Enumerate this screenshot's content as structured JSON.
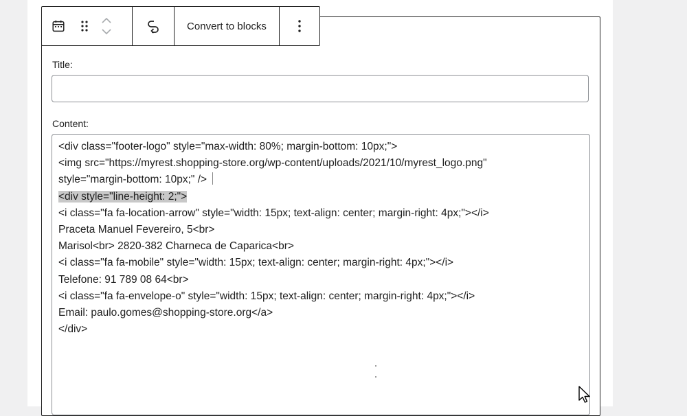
{
  "toolbar": {
    "convert_label": "Convert to blocks"
  },
  "form": {
    "title_label": "Title:",
    "title_value": "",
    "content_label": "Content:"
  },
  "content_lines": [
    "<div class=\"footer-logo\" style=\"max-width: 80%; margin-bottom: 10px;\">",
    "<img src=\"https://myrest.shopping-store.org/wp-content/uploads/2021/10/myrest_logo.png\"",
    "style=\"margin-bottom: 10px;\" />",
    "<div style=\"line-height: 2;\">",
    "<i class=\"fa fa-location-arrow\" style=\"width: 15px; text-align: center; margin-right: 4px;\"></i>",
    "Praceta Manuel Fevereiro, 5<br>",
    "Marisol<br> 2820-382 Charneca de Caparica<br>",
    "<i class=\"fa fa-mobile\" style=\"width: 15px; text-align: center; margin-right: 4px;\"></i>",
    "Telefone: 91 789 08 64<br>",
    "<i class=\"fa fa-envelope-o\" style=\"width: 15px; text-align: center; margin-right: 4px;\"></i>",
    "Email: paulo.gomes@shopping-store.org</a>",
    "</div>"
  ],
  "icons": {
    "block_type": "calendar-icon",
    "drag": "drag-handle-icon",
    "move_up": "chevron-up-icon",
    "move_down": "chevron-down-icon",
    "transform": "transform-icon",
    "more": "more-options-icon",
    "pointer": "mouse-pointer-icon"
  },
  "colors": {
    "border_dark": "#1e1e1e",
    "input_border": "#8c8f94",
    "selection": "#c8c8c8",
    "background": "#f0f0f1"
  }
}
